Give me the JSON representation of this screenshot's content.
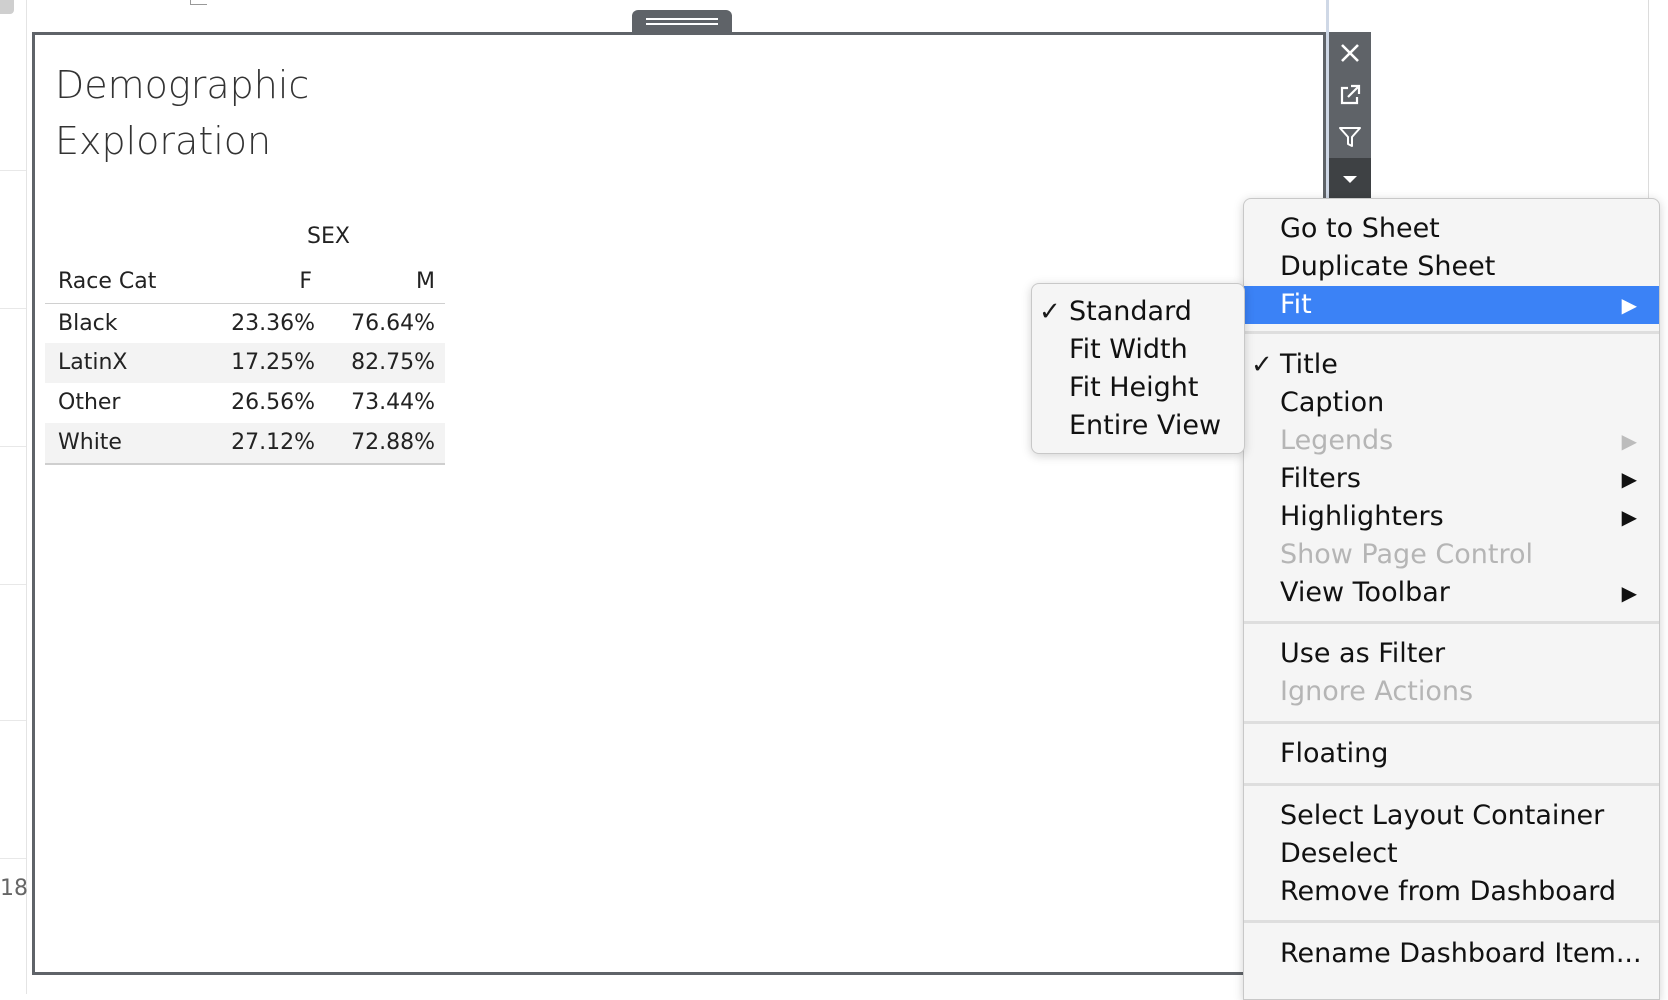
{
  "background": {
    "row_number": "18"
  },
  "sheet": {
    "title_line1": "Demographic",
    "title_line2": "Exploration",
    "crosstab": {
      "column_group_header": "SEX",
      "row_header": "Race Cat",
      "columns": [
        "F",
        "M"
      ],
      "rows": [
        {
          "label": "Black",
          "values": [
            "23.36%",
            "76.64%"
          ]
        },
        {
          "label": "LatinX",
          "values": [
            "17.25%",
            "82.75%"
          ]
        },
        {
          "label": "Other",
          "values": [
            "26.56%",
            "73.44%"
          ]
        },
        {
          "label": "White",
          "values": [
            "27.12%",
            "72.88%"
          ]
        }
      ]
    }
  },
  "toolbar": {
    "buttons": [
      "close-icon",
      "external-link-icon",
      "filter-icon",
      "dropdown-arrow-icon"
    ]
  },
  "context_menu": {
    "items": [
      {
        "label": "Go to Sheet"
      },
      {
        "label": "Duplicate Sheet"
      },
      {
        "label": "Fit",
        "submenu": true,
        "highlighted": true
      },
      {
        "label": "Title",
        "checked": true
      },
      {
        "label": "Caption"
      },
      {
        "label": "Legends",
        "disabled": true,
        "submenu": true
      },
      {
        "label": "Filters",
        "submenu": true
      },
      {
        "label": "Highlighters",
        "submenu": true
      },
      {
        "label": "Show Page Control",
        "disabled": true
      },
      {
        "label": "View Toolbar",
        "submenu": true
      },
      {
        "label": "Use as Filter"
      },
      {
        "label": "Ignore Actions",
        "disabled": true
      },
      {
        "label": "Floating"
      },
      {
        "label": "Select Layout Container"
      },
      {
        "label": "Deselect"
      },
      {
        "label": "Remove from Dashboard"
      },
      {
        "label": "Rename Dashboard Item..."
      }
    ]
  },
  "fit_submenu": {
    "items": [
      {
        "label": "Standard",
        "checked": true
      },
      {
        "label": "Fit Width"
      },
      {
        "label": "Fit Height"
      },
      {
        "label": "Entire View"
      }
    ]
  },
  "glyphs": {
    "check": "✓",
    "submenu_arrow": "▶"
  },
  "colors": {
    "menu_highlight": "#3b82f6",
    "frame": "#5f6368",
    "disabled_text": "#b5b5b5"
  }
}
